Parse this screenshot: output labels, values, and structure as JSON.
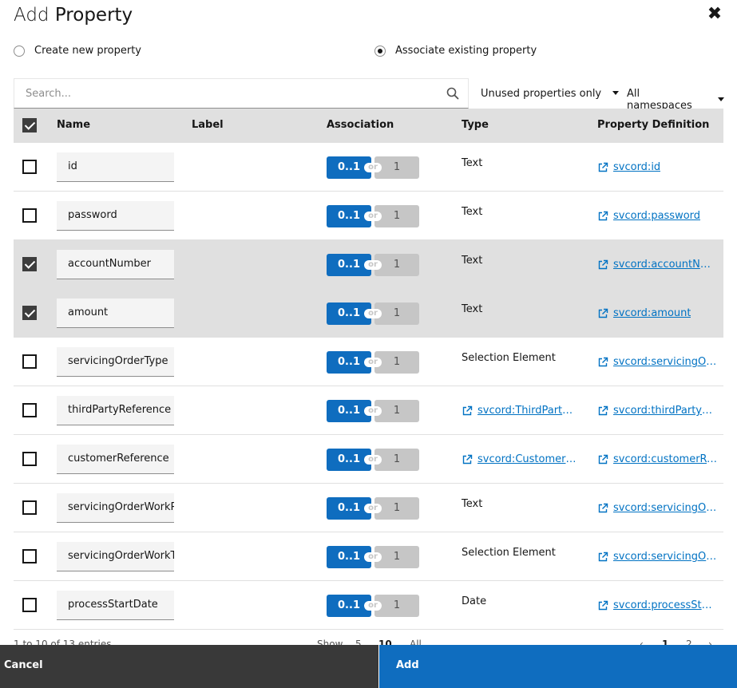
{
  "dialog": {
    "title_light": "Add",
    "title_strong": "Property",
    "close_glyph": "✖"
  },
  "mode": {
    "create_label": "Create new property",
    "associate_label": "Associate existing property",
    "selected": "associate"
  },
  "toolbar": {
    "search_placeholder": "Search...",
    "filter_label": "Unused properties only",
    "namespace_label": "All namespaces"
  },
  "table": {
    "columns": [
      "Name",
      "Label",
      "Association",
      "Type",
      "Property Definition"
    ],
    "header_checked": true,
    "assoc_opt1": "0..1",
    "assoc_or": "or",
    "assoc_opt2": "1",
    "rows": [
      {
        "checked": false,
        "name": "id",
        "type": "Text",
        "type_is_link": false,
        "def": "svcord:id"
      },
      {
        "checked": false,
        "name": "password",
        "type": "Text",
        "type_is_link": false,
        "def": "svcord:password"
      },
      {
        "checked": true,
        "name": "accountNumber",
        "type": "Text",
        "type_is_link": false,
        "def": "svcord:accountNumber"
      },
      {
        "checked": true,
        "name": "amount",
        "type": "Text",
        "type_is_link": false,
        "def": "svcord:amount"
      },
      {
        "checked": false,
        "name": "servicingOrderType",
        "type": "Selection Element",
        "type_is_link": false,
        "def": "svcord:servicingOrderType"
      },
      {
        "checked": false,
        "name": "thirdPartyReference",
        "type": "svcord:ThirdPartyReference",
        "type_is_link": true,
        "def": "svcord:thirdPartyReference"
      },
      {
        "checked": false,
        "name": "customerReference",
        "type": "svcord:CustomerReference",
        "type_is_link": true,
        "def": "svcord:customerReference"
      },
      {
        "checked": false,
        "name": "servicingOrderWorkProduct",
        "type": "Text",
        "type_is_link": false,
        "def": "svcord:servicingOrderWorkProduct"
      },
      {
        "checked": false,
        "name": "servicingOrderWorkType",
        "type": "Selection Element",
        "type_is_link": false,
        "def": "svcord:servicingOrderWorkType"
      },
      {
        "checked": false,
        "name": "processStartDate",
        "type": "Date",
        "type_is_link": false,
        "def": "svcord:processStartDate"
      }
    ]
  },
  "pagination": {
    "entries_text": "1 to 10 of 13 entries",
    "show_label": "Show",
    "page_sizes": [
      "5",
      "10",
      "All"
    ],
    "prev": "‹",
    "pages": [
      "1",
      "2"
    ],
    "next": "›"
  },
  "actions": {
    "cancel_label": "Cancel",
    "add_label": "Add"
  },
  "colors": {
    "primary": "#0f6dbf",
    "dark": "#393939",
    "selected_row": "#e0e0e0"
  }
}
